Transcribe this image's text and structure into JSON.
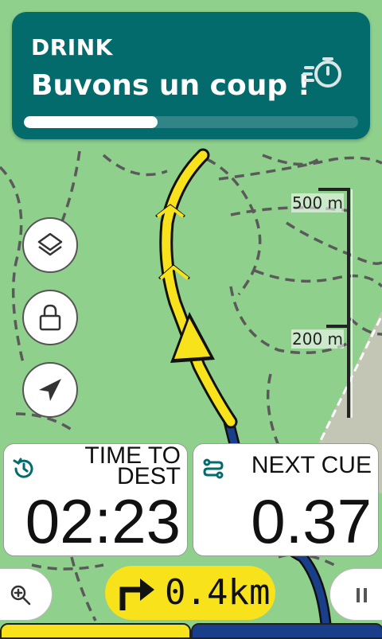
{
  "alert": {
    "kicker": "DRINK",
    "message": "Buvons un coup !",
    "icon": "stopwatch-icon",
    "progress": 0.4
  },
  "map": {
    "controls": [
      "layers-icon",
      "lock-icon",
      "navigation-arrow-icon"
    ],
    "scale": {
      "top_label": "500 m",
      "bottom_label": "200 m"
    },
    "colors": {
      "land": "#8fd08c",
      "route": "#f7e21b",
      "track": "#1a3f8a",
      "trail": "#555555"
    }
  },
  "fields": {
    "time_to_dest": {
      "label_line1": "TIME TO",
      "label_line2": "DEST",
      "value": "02:23",
      "icon": "history-icon"
    },
    "next_cue": {
      "label": "NEXT CUE",
      "value": "0.37",
      "icon": "route-icon"
    }
  },
  "bottom": {
    "turn_distance": "0.4km",
    "turn_icon": "turn-right-icon",
    "zoom_icon": "zoom-in-icon",
    "pause_icon": "pause-icon"
  },
  "accent": "#046b6c"
}
